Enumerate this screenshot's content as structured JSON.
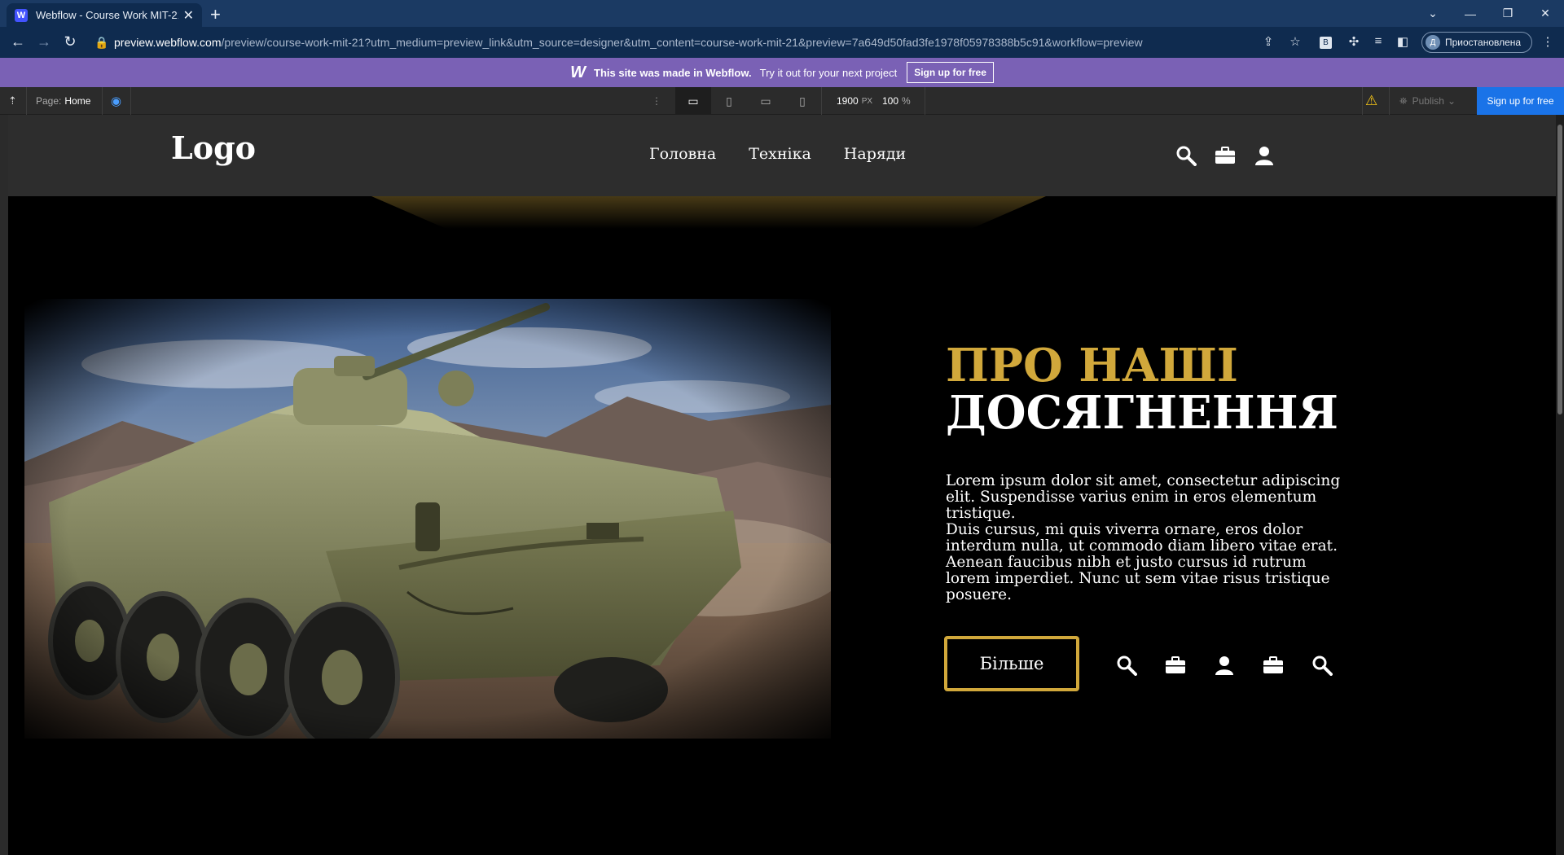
{
  "browser": {
    "tab_title": "Webflow - Course Work MIT-21",
    "favicon_letter": "W",
    "url_host": "preview.webflow.com",
    "url_path": "/preview/course-work-mit-21?utm_medium=preview_link&utm_source=designer&utm_content=course-work-mit-21&preview=7a649d50fad3fe1978f05978388b5c91&workflow=preview",
    "profile_initial": "Д",
    "profile_label": "Приостановлена",
    "ext_badge": "B"
  },
  "webflow_banner": {
    "made_text": "This site was made in Webflow.",
    "try_text": "Try it out for your next project",
    "signup_label": "Sign up for free"
  },
  "toolbar": {
    "page_label": "Page:",
    "page_name": "Home",
    "width_value": "1900",
    "width_unit": "PX",
    "zoom_value": "100",
    "zoom_unit": "%",
    "publish_label": "Publish",
    "signup_label": "Sign up for free"
  },
  "site": {
    "logo": "Logo",
    "nav": [
      "Головна",
      "Техніка",
      "Наряди"
    ],
    "heading_line1": "ПРО НАШІ",
    "heading_line2": "ДОСЯГНЕННЯ",
    "paragraph1": "Lorem ipsum dolor sit amet, consectetur adipiscing elit. Suspendisse varius enim in eros elementum tristique.",
    "paragraph2": "Duis cursus, mi quis viverra ornare, eros dolor interdum nulla, ut commodo diam libero vitae erat. Aenean faucibus nibh et justo cursus id rutrum lorem imperdiet. Nunc ut sem vitae risus tristique posuere.",
    "button_label": "Більше",
    "accent_color": "#d1a83b",
    "header_icons": [
      "search-icon",
      "briefcase-icon",
      "user-icon"
    ],
    "row_icons": [
      "search-icon",
      "briefcase-icon",
      "user-icon",
      "briefcase-icon",
      "search-icon"
    ]
  }
}
